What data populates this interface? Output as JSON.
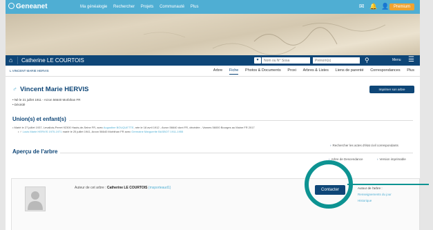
{
  "topbar": {
    "logo": "Geneanet",
    "nav": [
      "Ma généalogie",
      "Rechercher",
      "Projets",
      "Communauté",
      "Plus"
    ],
    "premium_label": "Premium"
  },
  "personbar": {
    "name": "Catherine LE COURTOIS",
    "search_nom_placeholder": "Nom ou N° Sosa",
    "search_prenom_placeholder": "Prénom(s)",
    "menu_label": "Menu"
  },
  "tabs": {
    "owner": "L VINCENT MARIE HERVIS",
    "items": [
      "Arbre",
      "Fiche",
      "Photos & Documents",
      "Proxi",
      "Arbres & Listes",
      "Liens de parenté",
      "Correspondances",
      "Plus"
    ],
    "active": "Fiche"
  },
  "person": {
    "name": "Vincent Marie HERVIS",
    "print_label": "Imprimer son arbre",
    "birth": "Né le 21 juillet 1911 - Arzon 56640 Morbihan FR",
    "death": "Décédé"
  },
  "unions": {
    "title": "Union(s) et enfant(s)",
    "line1_prefix": "Marié le 27 juillet 1937, Levallois-Perret 92300 Hauts-de-Seine FR, avec ",
    "line1_spouse": "Augustine BOUQUETTE",
    "line1_suffix": ", née le 18 avril 1912 - Arzon 56640 dont FR, décédée - Vannes 56000 Bourges au Maine FR 2017",
    "line2_prefix": "♂ ",
    "line2_child": "Louis Marie HERVIS 1975-1971",
    "line2_suffix": " marié le 25 juillet 1941, Arzon 56640 Morbihan FR avec ",
    "line2_spouse": "Germaine Marguerite BASBOT 1911-1955",
    "link": "Rechercher les actes d'état civil correspondants"
  },
  "apercu": {
    "title": "Aperçu de l'arbre",
    "link1": "Arbre de Descendance",
    "link2": "Version imprimable"
  },
  "author": {
    "prefix": "Auteur de cet arbre : ",
    "name": "Catherine LE COURTOIS",
    "pseudo": "(msporteaud1)",
    "contact_label": "Contacter",
    "about_title": "Autour de l'arbre :",
    "about_link1": "Renseignements du jour",
    "about_link2": "Historique"
  },
  "colors": {
    "topbar": "#4faed3",
    "navy": "#0e4677",
    "highlight": "#0d9392",
    "premium": "#f0a330"
  }
}
